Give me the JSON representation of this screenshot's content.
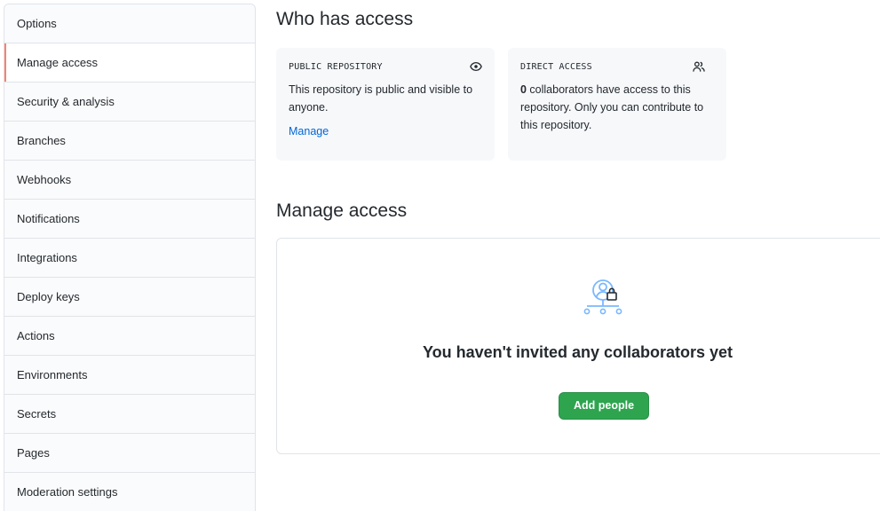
{
  "sidebar": {
    "items": [
      {
        "label": "Options"
      },
      {
        "label": "Manage access"
      },
      {
        "label": "Security & analysis"
      },
      {
        "label": "Branches"
      },
      {
        "label": "Webhooks"
      },
      {
        "label": "Notifications"
      },
      {
        "label": "Integrations"
      },
      {
        "label": "Deploy keys"
      },
      {
        "label": "Actions"
      },
      {
        "label": "Environments"
      },
      {
        "label": "Secrets"
      },
      {
        "label": "Pages"
      },
      {
        "label": "Moderation settings"
      }
    ],
    "selected": "Manage access",
    "accent_color": "#f9826c"
  },
  "who_has_access": {
    "title": "Who has access",
    "public_card": {
      "kicker": "PUBLIC REPOSITORY",
      "icon": "eye-icon",
      "text": "This repository is public and visible to anyone.",
      "link": "Manage"
    },
    "direct_card": {
      "kicker": "DIRECT ACCESS",
      "icon": "people-icon",
      "count": "0",
      "text": " collaborators have access to this repository. Only you can contribute to this repository."
    }
  },
  "manage_access": {
    "title": "Manage access",
    "empty_icon": "collaborators-lock-icon",
    "empty_title": "You haven't invited any collaborators yet",
    "add_button": "Add people",
    "button_color": "#2ea44f",
    "link_color": "#0366d6"
  }
}
